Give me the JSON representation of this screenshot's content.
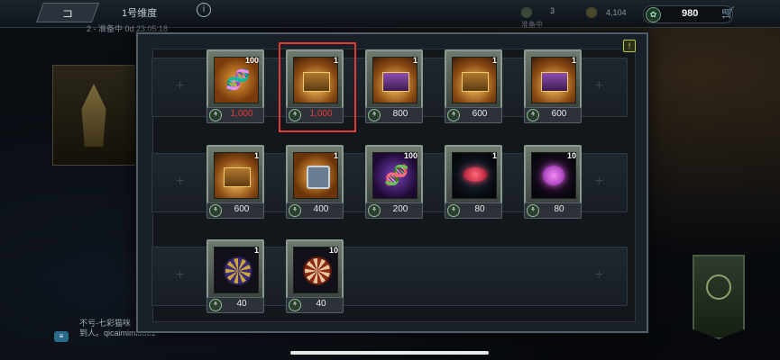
{
  "header": {
    "back_label": "⊐",
    "dimension_title": "1号维度",
    "info_icon": "info-icon",
    "status_line": "2 - 准备中 0d 23:05:18",
    "resource_1": "3",
    "resource_2": "4,104",
    "resource_sub": "准备中",
    "currency_value": "980",
    "currency_icon": "gold-coin-icon",
    "cart_icon": "cart-icon"
  },
  "chat": {
    "line1": "不亏-七彩猫咪",
    "line2": "到人。qicaimimi0001"
  },
  "modal": {
    "corner_icon": "!",
    "items": [
      {
        "qty": "100",
        "price": "1,000",
        "price_color": "red",
        "art": "dna-gold"
      },
      {
        "qty": "1",
        "price": "1,000",
        "price_color": "red",
        "art": "chest-green",
        "selected": true
      },
      {
        "qty": "1",
        "price": "800",
        "art": "chest-purple"
      },
      {
        "qty": "1",
        "price": "600",
        "art": "chest-gold"
      },
      {
        "qty": "1",
        "price": "600",
        "art": "chest-red"
      },
      {
        "qty": "1",
        "price": "600",
        "art": "chest-gold-2"
      },
      {
        "qty": "1",
        "price": "400",
        "art": "lock-box"
      },
      {
        "qty": "100",
        "price": "200",
        "art": "dna-purple"
      },
      {
        "qty": "1",
        "price": "80",
        "art": "capsule-red"
      },
      {
        "qty": "10",
        "price": "80",
        "art": "capsule-pink"
      },
      {
        "qty": "1",
        "price": "40",
        "art": "chip-purple"
      },
      {
        "qty": "10",
        "price": "40",
        "art": "chip-red"
      }
    ],
    "coin_glyph": "⚘"
  }
}
